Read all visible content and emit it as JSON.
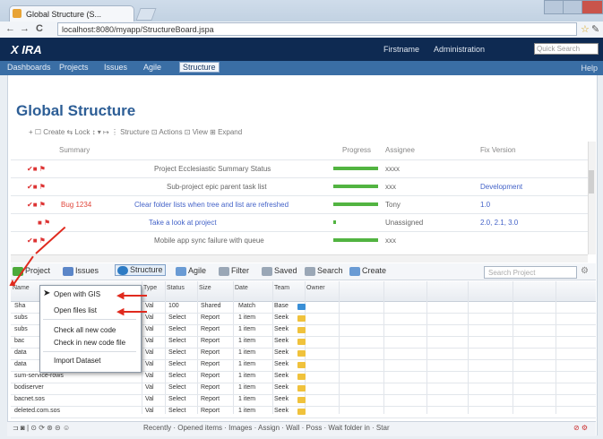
{
  "browser": {
    "tab_title": "Global Structure (S...",
    "address": "localhost:8080/myapp/StructureBoard.jspa",
    "back": "←",
    "forward": "→",
    "reload": "C",
    "star": "☆",
    "wrench": "✎"
  },
  "app": {
    "logo": "X IRA",
    "header_right": [
      "Firstname",
      "Administration",
      "Quick Search"
    ],
    "menu": [
      "Dashboards",
      "Projects",
      "Issues",
      "Agile",
      "Structure"
    ],
    "active_menu": "Structure",
    "help": "Help"
  },
  "page": {
    "title": "Global Structure",
    "toolbar": "+ ☐ Create  ⇆  Lock   ↕  ▾  ↦   ⋮ Structure  ⊡ Actions  ⊡ View  ⊞ Expand"
  },
  "columns": [
    "Summary",
    "Progress",
    "Assignee",
    "Fix Version"
  ],
  "rows": [
    {
      "key": "",
      "summary": "Project Ecclesiastic Summary Status",
      "assignee": "xxxx",
      "fix": "",
      "progress": 0.8
    },
    {
      "key": "",
      "summary": "Sub-project epic parent task list",
      "assignee": "xxx",
      "fix": "Development",
      "progress": 0.8
    },
    {
      "key": "Bug 1234",
      "summary": "Clear folder lists when tree and list are refreshed",
      "assignee": "Tony",
      "fix": "1.0",
      "progress": 0.8
    },
    {
      "key": "",
      "summary": "Take a look at project",
      "assignee": "Unassigned",
      "fix": "2.0, 2.1, 3.0",
      "progress": 0.05
    },
    {
      "key": "",
      "summary": "Mobile app sync failure with queue",
      "assignee": "xxx",
      "fix": "",
      "progress": 0.8
    }
  ],
  "bottom_toolbar": [
    {
      "label": "Project",
      "icon": "green"
    },
    {
      "label": "Issues",
      "icon": "blue"
    },
    {
      "label": "Structure",
      "icon": "blue",
      "selected": true
    },
    {
      "label": "Agile",
      "icon": "blue"
    },
    {
      "label": "Filter",
      "icon": "gray"
    },
    {
      "label": "Saved",
      "icon": "gray"
    },
    {
      "label": "Search",
      "icon": "gray"
    },
    {
      "label": "Create",
      "icon": "blue"
    }
  ],
  "search_placeholder": "Search Project",
  "grid_columns": [
    "Name",
    "Type",
    "Status",
    "Size",
    "Date",
    "Team",
    "Owner"
  ],
  "grid_rows": [
    {
      "name": "Sha",
      "type": "Val",
      "status": "100",
      "size": "Shared",
      "date": "Match",
      "team": "Base"
    },
    {
      "name": "subs",
      "type": "Val",
      "status": "Select",
      "size": "Report",
      "date": "1 item",
      "team": "Seek"
    },
    {
      "name": "subs",
      "type": "Val",
      "status": "Select",
      "size": "Report",
      "date": "1 item",
      "team": "Seek"
    },
    {
      "name": "bac",
      "type": "Val",
      "status": "Select",
      "size": "Report",
      "date": "1 item",
      "team": "Seek"
    },
    {
      "name": "data",
      "type": "Val",
      "status": "Select",
      "size": "Report",
      "date": "1 item",
      "team": "Seek"
    },
    {
      "name": "data",
      "type": "Val",
      "status": "Select",
      "size": "Report",
      "date": "1 item",
      "team": "Seek"
    },
    {
      "name": "sum-service-rows",
      "type": "Val",
      "status": "Select",
      "size": "Report",
      "date": "1 item",
      "team": "Seek"
    },
    {
      "name": "bodiserver",
      "type": "Val",
      "status": "Select",
      "size": "Report",
      "date": "1 item",
      "team": "Seek"
    },
    {
      "name": "bacnet.sos",
      "type": "Val",
      "status": "Select",
      "size": "Report",
      "date": "1 item",
      "team": "Seek"
    },
    {
      "name": "deleted.com.sos",
      "type": "Val",
      "status": "Select",
      "size": "Report",
      "date": "1 item",
      "team": "Seek"
    }
  ],
  "context_menu": [
    "Open with GIS",
    "Open files list",
    "Check all new code",
    "Check in new code file",
    "Import Dataset"
  ],
  "status": "Recently  ·  Opened items  ·  Images  ·  Assign  ·  Wall  ·  Poss  ·  Wait folder in  ·  Star",
  "colors": {
    "navy": "#0e2a52",
    "menu": "#3a6ea5",
    "title": "#2d5e96",
    "progress": "#52b441",
    "arrow": "#e02a1e"
  }
}
